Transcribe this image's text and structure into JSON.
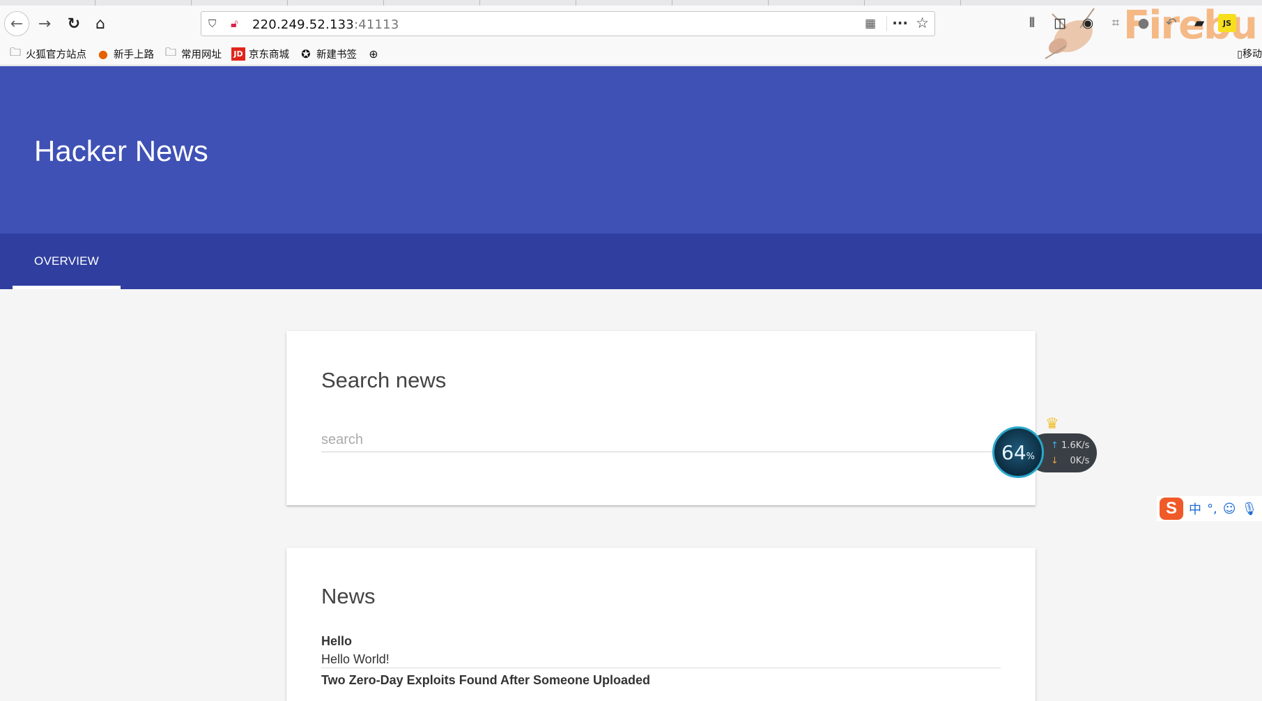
{
  "browser": {
    "url_host": "220.249.52.133",
    "url_port": ":41113",
    "bookmarks": [
      {
        "label": "火狐官方站点",
        "icon": "folder-icon"
      },
      {
        "label": "新手上路",
        "icon": "firefox-icon"
      },
      {
        "label": "常用网址",
        "icon": "folder-icon"
      },
      {
        "label": "京东商城",
        "icon": "jd-icon"
      },
      {
        "label": "新建书签",
        "icon": "bookmark-icon"
      }
    ],
    "mobile_bookmarks": "移动",
    "toolbar_js_label": "JS",
    "firebug_text": "Firebu"
  },
  "page": {
    "title": "Hacker News",
    "tabs": [
      {
        "label": "OVERVIEW",
        "active": true
      }
    ],
    "search_card": {
      "title": "Search news",
      "placeholder": "search"
    },
    "news_card": {
      "title": "News",
      "items": [
        {
          "title": "Hello",
          "body": "Hello World!"
        },
        {
          "title": "Two Zero-Day Exploits Found After Someone Uploaded",
          "body": ""
        }
      ]
    }
  },
  "overlays": {
    "network_widget": {
      "percent": "64",
      "percent_unit": "%",
      "upload": "1.6",
      "upload_unit": "K/s",
      "download": "0",
      "download_unit": "K/s"
    },
    "ime": {
      "logo": "S",
      "lang": "中",
      "punct": "°,"
    }
  },
  "colors": {
    "header": "#3f51b5",
    "tabbar": "#303f9f",
    "page_bg": "#f5f5f5"
  }
}
